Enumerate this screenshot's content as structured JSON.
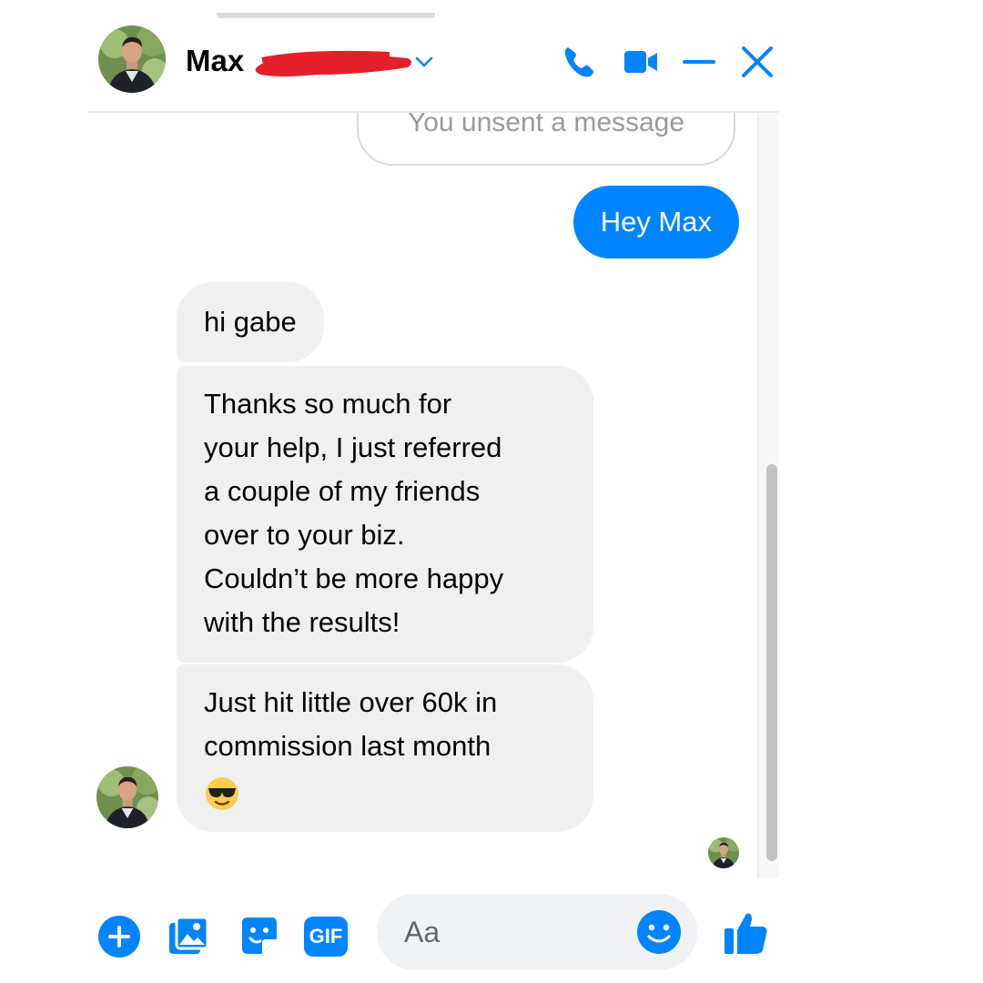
{
  "colors": {
    "accent": "#0084ff",
    "incoming_bubble": "#f0f0f0",
    "redaction": "#e3202a"
  },
  "header": {
    "contact_name": "Max",
    "avatar": "person-photo",
    "icons": [
      "phone-icon",
      "video-camera-icon",
      "minimize-icon",
      "close-icon"
    ]
  },
  "messages": {
    "unsent_notice": "You unsent a message",
    "outgoing": [
      {
        "text": "Hey Max"
      }
    ],
    "incoming": [
      {
        "text": "hi gabe"
      },
      {
        "lines": [
          "Thanks so much for",
          "your help, I just referred",
          "a couple of my friends",
          "over to your biz.",
          "Couldn’t be more happy",
          "with the results!"
        ]
      },
      {
        "lines": [
          "Just hit little over 60k in",
          "commission last month"
        ],
        "emoji": "smiling-face-with-sunglasses"
      }
    ]
  },
  "composer": {
    "placeholder": "Aa",
    "gif_label": "GIF",
    "icons": [
      "plus-icon",
      "photo-icon",
      "sticker-icon",
      "gif-icon",
      "emoji-icon",
      "thumbs-up-icon"
    ]
  }
}
